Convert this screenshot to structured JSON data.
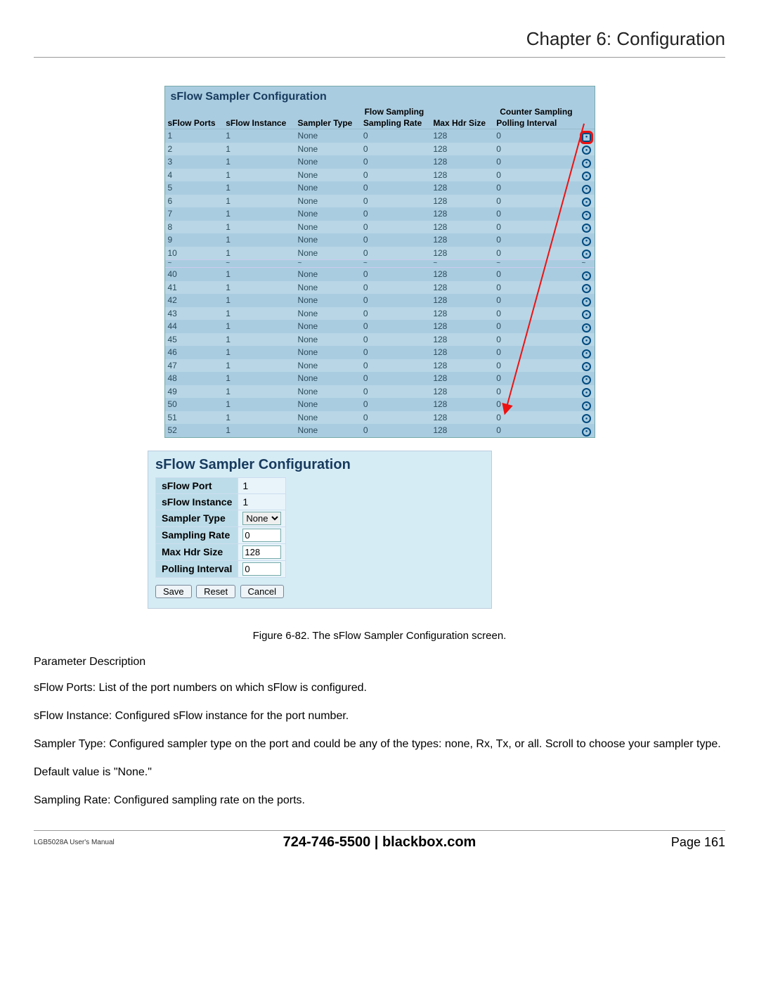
{
  "chapter_title": "Chapter 6: Configuration",
  "table1": {
    "title": "sFlow Sampler Configuration",
    "group_flow": "Flow Sampling",
    "group_counter": "Counter Sampling",
    "headers": {
      "ports": "sFlow Ports",
      "instance": "sFlow Instance",
      "stype": "Sampler Type",
      "srate": "Sampling Rate",
      "hdr": "Max Hdr Size",
      "poll": "Polling Interval"
    },
    "rows_top": [
      {
        "port": "1",
        "inst": "1",
        "type": "None",
        "rate": "0",
        "hdr": "128",
        "poll": "0"
      },
      {
        "port": "2",
        "inst": "1",
        "type": "None",
        "rate": "0",
        "hdr": "128",
        "poll": "0"
      },
      {
        "port": "3",
        "inst": "1",
        "type": "None",
        "rate": "0",
        "hdr": "128",
        "poll": "0"
      },
      {
        "port": "4",
        "inst": "1",
        "type": "None",
        "rate": "0",
        "hdr": "128",
        "poll": "0"
      },
      {
        "port": "5",
        "inst": "1",
        "type": "None",
        "rate": "0",
        "hdr": "128",
        "poll": "0"
      },
      {
        "port": "6",
        "inst": "1",
        "type": "None",
        "rate": "0",
        "hdr": "128",
        "poll": "0"
      },
      {
        "port": "7",
        "inst": "1",
        "type": "None",
        "rate": "0",
        "hdr": "128",
        "poll": "0"
      },
      {
        "port": "8",
        "inst": "1",
        "type": "None",
        "rate": "0",
        "hdr": "128",
        "poll": "0"
      },
      {
        "port": "9",
        "inst": "1",
        "type": "None",
        "rate": "0",
        "hdr": "128",
        "poll": "0"
      },
      {
        "port": "10",
        "inst": "1",
        "type": "None",
        "rate": "0",
        "hdr": "128",
        "poll": "0"
      }
    ],
    "rows_bottom": [
      {
        "port": "40",
        "inst": "1",
        "type": "None",
        "rate": "0",
        "hdr": "128",
        "poll": "0"
      },
      {
        "port": "41",
        "inst": "1",
        "type": "None",
        "rate": "0",
        "hdr": "128",
        "poll": "0"
      },
      {
        "port": "42",
        "inst": "1",
        "type": "None",
        "rate": "0",
        "hdr": "128",
        "poll": "0"
      },
      {
        "port": "43",
        "inst": "1",
        "type": "None",
        "rate": "0",
        "hdr": "128",
        "poll": "0"
      },
      {
        "port": "44",
        "inst": "1",
        "type": "None",
        "rate": "0",
        "hdr": "128",
        "poll": "0"
      },
      {
        "port": "45",
        "inst": "1",
        "type": "None",
        "rate": "0",
        "hdr": "128",
        "poll": "0"
      },
      {
        "port": "46",
        "inst": "1",
        "type": "None",
        "rate": "0",
        "hdr": "128",
        "poll": "0"
      },
      {
        "port": "47",
        "inst": "1",
        "type": "None",
        "rate": "0",
        "hdr": "128",
        "poll": "0"
      },
      {
        "port": "48",
        "inst": "1",
        "type": "None",
        "rate": "0",
        "hdr": "128",
        "poll": "0"
      },
      {
        "port": "49",
        "inst": "1",
        "type": "None",
        "rate": "0",
        "hdr": "128",
        "poll": "0"
      },
      {
        "port": "50",
        "inst": "1",
        "type": "None",
        "rate": "0",
        "hdr": "128",
        "poll": "0"
      },
      {
        "port": "51",
        "inst": "1",
        "type": "None",
        "rate": "0",
        "hdr": "128",
        "poll": "0"
      },
      {
        "port": "52",
        "inst": "1",
        "type": "None",
        "rate": "0",
        "hdr": "128",
        "poll": "0"
      }
    ]
  },
  "detail": {
    "title": "sFlow Sampler Configuration",
    "fields": {
      "port_l": "sFlow Port",
      "port_v": "1",
      "inst_l": "sFlow Instance",
      "inst_v": "1",
      "type_l": "Sampler Type",
      "type_v": "None",
      "rate_l": "Sampling Rate",
      "rate_v": "0",
      "hdr_l": "Max Hdr Size",
      "hdr_v": "128",
      "poll_l": "Polling Interval",
      "poll_v": "0"
    },
    "buttons": {
      "save": "Save",
      "reset": "Reset",
      "cancel": "Cancel"
    }
  },
  "caption": "Figure 6-82. The sFlow Sampler Configuration screen.",
  "params": {
    "heading": "Parameter Description",
    "p1_b": "sFlow Ports: ",
    "p1": "List of the port numbers on which sFlow is configured.",
    "p2_b": "sFlow Instance: ",
    "p2": "Configured sFlow instance for the port number.",
    "p3_b": "Sampler Type: ",
    "p3": "Configured sampler type on the port and could be any of the types: none, Rx, Tx, or all. Scroll to choose your sampler type.",
    "p4": "Default value is \"None.\"",
    "p5_b": "Sampling Rate: ",
    "p5": "Configured sampling rate on the ports."
  },
  "footer": {
    "manual": "LGB5028A User's Manual",
    "center": "724-746-5500   |   blackbox.com",
    "page": "Page 161"
  }
}
